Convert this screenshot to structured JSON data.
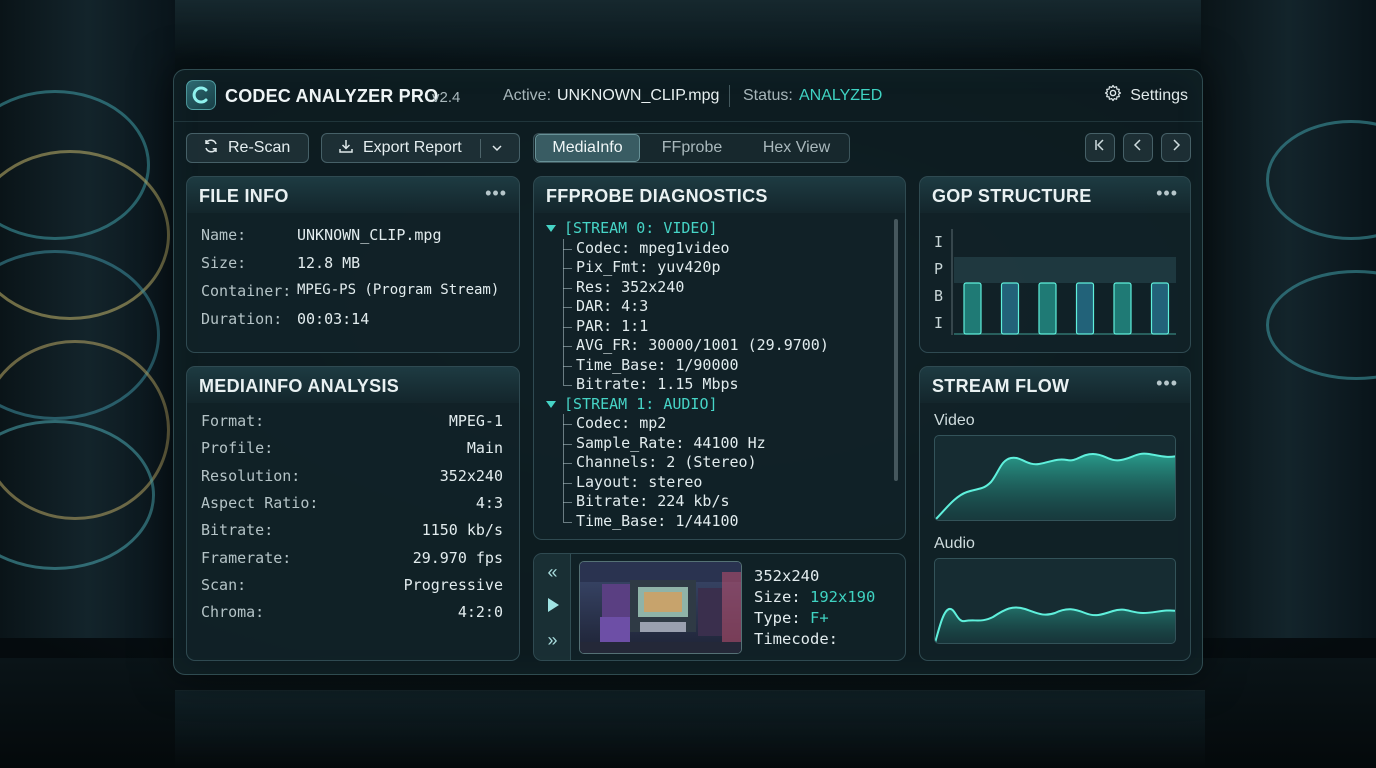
{
  "app": {
    "title": "CODEC ANALYZER PRO",
    "version": "v2.4",
    "active_label": "Active:",
    "active_file": "UNKNOWN_CLIP.mpg",
    "status_label": "Status:",
    "status_value": "ANALYZED",
    "settings_label": "Settings",
    "logo_letter": "C"
  },
  "toolbar": {
    "rescan_label": "Re-Scan",
    "export_label": "Export Report",
    "tabs": [
      {
        "label": "MediaInfo",
        "active": true
      },
      {
        "label": "FFprobe",
        "active": false
      },
      {
        "label": "Hex View",
        "active": false
      }
    ]
  },
  "file_info": {
    "title": "FILE INFO",
    "rows": [
      {
        "key": "Name:",
        "value": "UNKNOWN_CLIP.mpg"
      },
      {
        "key": "Size:",
        "value": "12.8 MB"
      },
      {
        "key": "Container:",
        "value": "MPEG-PS (Program Stream)"
      },
      {
        "key": "Duration:",
        "value": "00:03:14"
      }
    ]
  },
  "mediainfo": {
    "title": "MEDIAINFO ANALYSIS",
    "rows": [
      {
        "key": "Format:",
        "value": "MPEG-1"
      },
      {
        "key": "Profile:",
        "value": "Main"
      },
      {
        "key": "Resolution:",
        "value": "352x240"
      },
      {
        "key": "Aspect Ratio:",
        "value": "4:3"
      },
      {
        "key": "Bitrate:",
        "value": "1150 kb/s"
      },
      {
        "key": "Framerate:",
        "value": "29.970 fps"
      },
      {
        "key": "Scan:",
        "value": "Progressive"
      },
      {
        "key": "Chroma:",
        "value": "4:2:0"
      }
    ]
  },
  "ffprobe": {
    "title": "FFPROBE DIAGNOSTICS",
    "streams": [
      {
        "header": "[STREAM 0: VIDEO]",
        "items": [
          "Codec: mpeg1video",
          "Pix_Fmt: yuv420p",
          "Res: 352x240",
          "DAR: 4:3",
          "PAR: 1:1",
          "AVG_FR: 30000/1001 (29.9700)",
          "Time_Base: 1/90000",
          "Bitrate: 1.15 Mbps"
        ]
      },
      {
        "header": "[STREAM 1: AUDIO]",
        "items": [
          "Codec: mp2",
          "Sample_Rate: 44100 Hz",
          "Channels: 2 (Stereo)",
          "Layout: stereo",
          "Bitrate: 224 kb/s",
          "Time_Base: 1/44100"
        ]
      }
    ]
  },
  "preview": {
    "resolution": "352x240",
    "size_label": "Size:",
    "size_value": "192x190",
    "type_label": "Type:",
    "type_value": "F+",
    "timecode_label": "Timecode:"
  },
  "gop": {
    "title": "GOP STRUCTURE",
    "axis_labels": [
      "I",
      "P",
      "B",
      "I"
    ],
    "bars": 6
  },
  "stream_flow": {
    "title": "STREAM FLOW",
    "video_label": "Video",
    "audio_label": "Audio"
  },
  "colors": {
    "accent": "#3fd3c2",
    "panel_bg": "#12222a",
    "text": "#e2ecee"
  }
}
